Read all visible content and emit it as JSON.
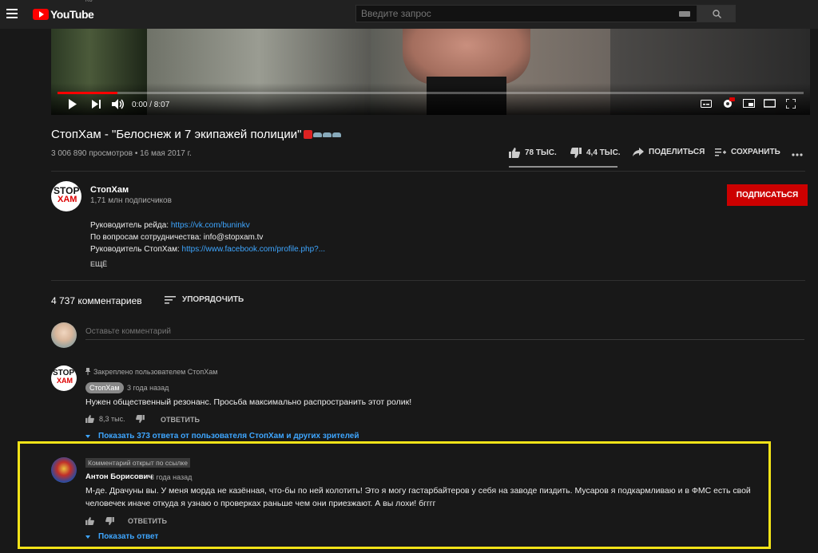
{
  "header": {
    "logo_text": "YouTube",
    "logo_region": "RU",
    "search_placeholder": "Введите запрос"
  },
  "player": {
    "time": "0:00 / 8:07",
    "progress_fraction": 0.08,
    "hd_badge": "HD"
  },
  "video": {
    "title": "СтопХам - \"Белоснеж и 7 экипажей полиции\"",
    "views_date": "3 006 890 просмотров • 16 мая 2017 г.",
    "likes": "78 ТЫС.",
    "dislikes": "4,4 ТЫС.",
    "share_label": "ПОДЕЛИТЬСЯ",
    "save_label": "СОХРАНИТЬ"
  },
  "channel": {
    "name": "СтопХам",
    "subscribers": "1,71 млн подписчиков",
    "subscribe_label": "ПОДПИСАТЬСЯ",
    "avatar_top": "STOP",
    "avatar_bottom": "ХАМ",
    "description": [
      {
        "text": "Руководитель рейда: ",
        "link": "https://vk.com/buninkv"
      },
      {
        "text": "По вопросам сотрудничества: info@stopxam.tv",
        "link": ""
      },
      {
        "text": "Руководитель СтопХам: ",
        "link": "https://www.facebook.com/profile.php?..."
      }
    ],
    "more_label": "ЕЩЁ"
  },
  "comments": {
    "count": "4 737 комментариев",
    "sort_label": "УПОРЯДОЧИТЬ",
    "add_placeholder": "Оставьте комментарий",
    "pinned": {
      "pinned_label": "Закреплено пользователем СтопХам",
      "author": "СтопХам",
      "time": "3 года назад",
      "text": "Нужен общественный резонанс. Просьба максимально распространить этот ролик!",
      "likes": "8,3 тыс.",
      "reply_label": "ОТВЕТИТЬ",
      "show_replies": "Показать 373 ответа от пользователя СтопХам и других зрителей"
    },
    "linked": {
      "badge": "Комментарий открыт по ссылке",
      "author": "Антон Борисович",
      "time": "3 года назад",
      "text_line1": "М-де. Драчуны вы. У меня морда не казённая, что-бы по ней колотить! Это я могу гастарбайтеров у себя на заводе пиздить. Мусаров я подкармливаю и в ФМС есть свой",
      "text_line2": "человечек иначе откуда я узнаю о проверках раньше чем они приезжают. А вы лохи! бгггг",
      "reply_label": "ОТВЕТИТЬ",
      "show_replies": "Показать ответ"
    }
  },
  "colors": {
    "accent_red": "#cc0000",
    "link_blue": "#3ea6ff",
    "highlight_yellow": "#f2e318",
    "background": "#181818"
  }
}
